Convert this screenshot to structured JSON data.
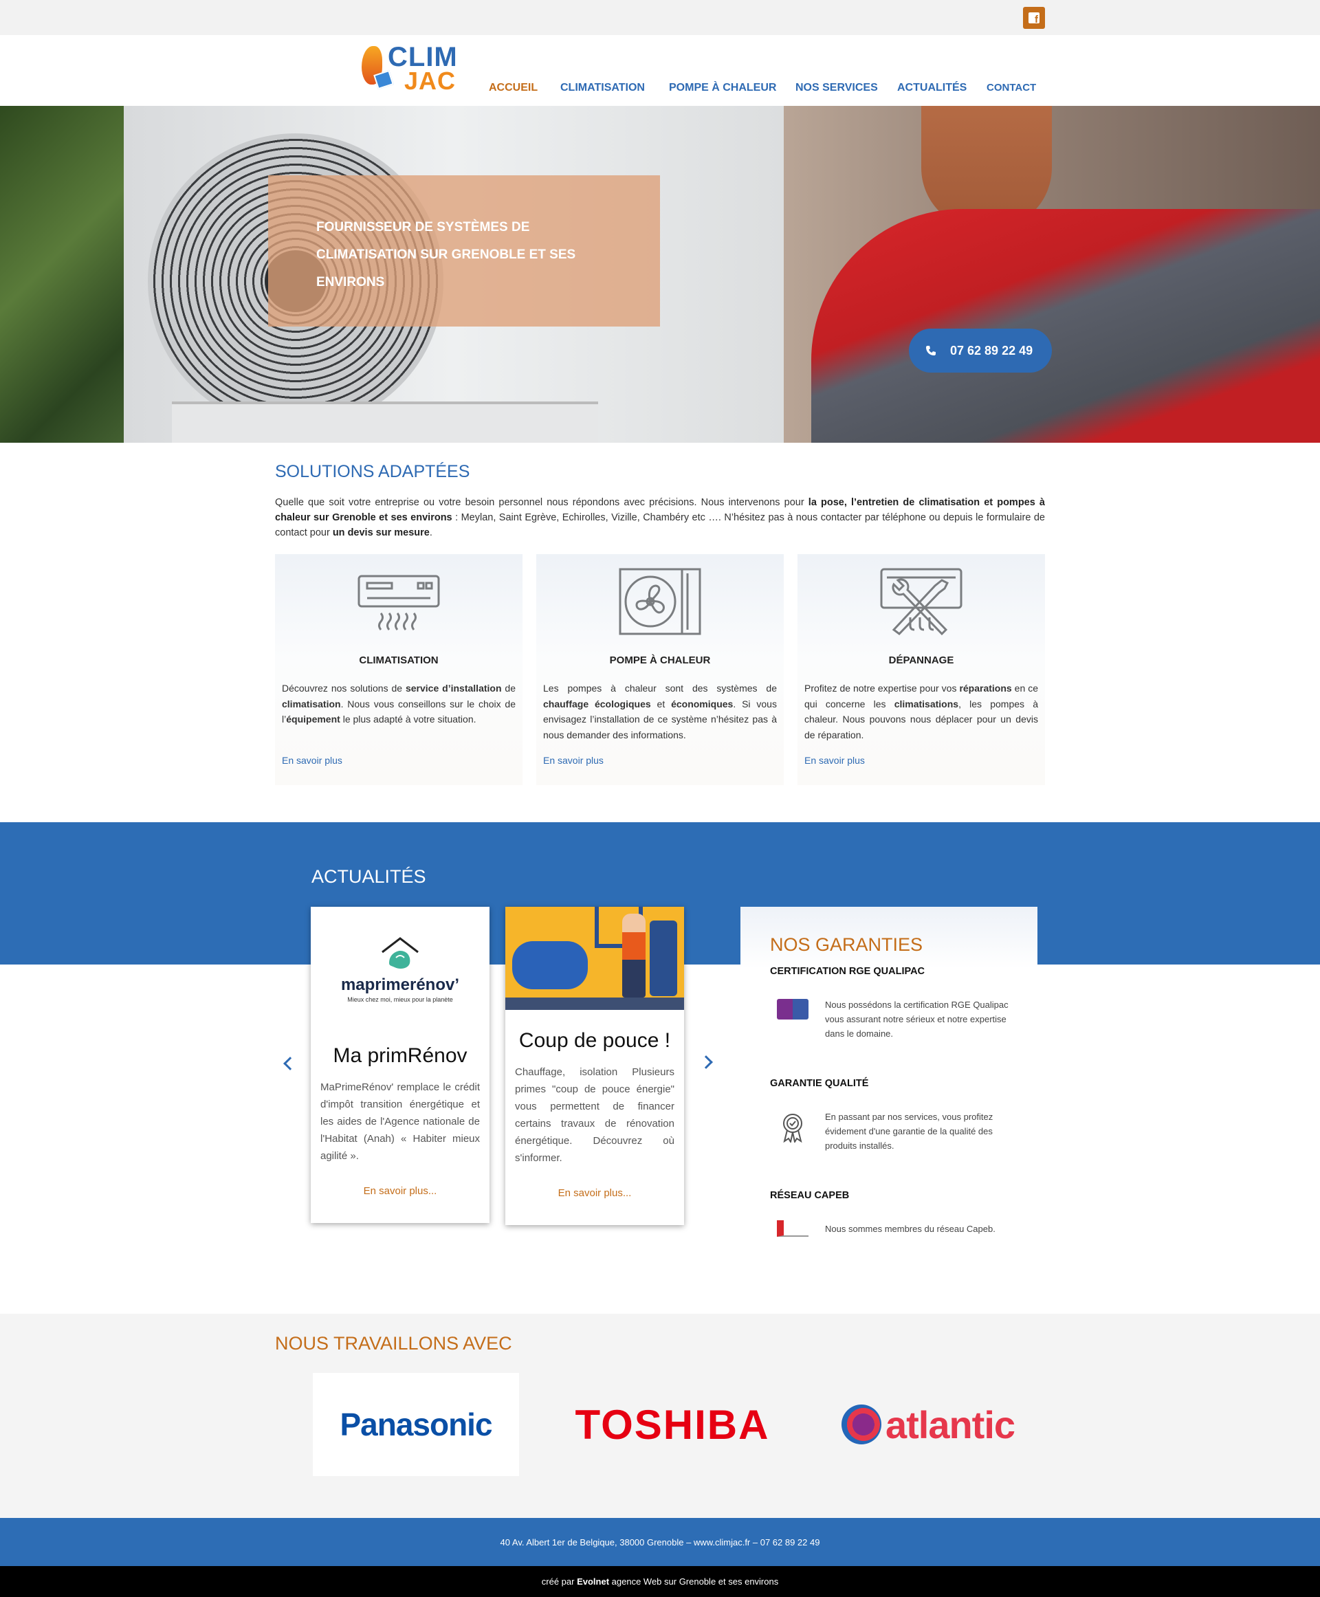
{
  "header": {
    "logo_line1": "CLIM",
    "logo_line2": "JAC",
    "nav": [
      "ACCUEIL",
      "CLIMATISATION",
      "POMPE À CHALEUR",
      "NOS SERVICES",
      "ACTUALITÉS",
      "CONTACT"
    ],
    "active": "ACCUEIL"
  },
  "hero": {
    "caption": "FOURNISSEUR DE SYSTÈMES DE CLIMATISATION SUR GRENOBLE ET SES ENVIRONS",
    "phone": "07 62 89 22 49"
  },
  "solutions": {
    "title": "SOLUTIONS ADAPTÉES",
    "intro": {
      "p1": "Quelle que soit votre entreprise ou votre besoin personnel nous répondons avec précisions. Nous intervenons pour ",
      "b1": "la pose, l’entretien  de climatisation et pompes à chaleur sur Grenoble et ses environs",
      "p2": " : Meylan, Saint Egrève, Echirolles, Vizille, Chambéry etc …. N’hésitez pas à nous contacter par téléphone ou depuis le formulaire de contact pour ",
      "b2": "un devis sur mesure",
      "p3": "."
    },
    "cards": [
      {
        "icon": "air-conditioner-icon",
        "title": "CLIMATISATION",
        "desc_parts": [
          "Découvrez nos solutions de ",
          "service d’installation",
          " de ",
          "climatisation",
          ". Nous vous conseillons sur le choix de l’",
          "équipement",
          " le plus adapté à votre situation."
        ],
        "link": "En savoir plus"
      },
      {
        "icon": "heat-pump-fan-icon",
        "title": "POMPE À CHALEUR",
        "desc_parts": [
          "Les pompes à chaleur sont des systèmes de ",
          "chauffage écologiques",
          " et ",
          "économiques",
          ". Si vous envisagez l’installation de ce système n’hésitez pas à nous demander des informations."
        ],
        "link": "En savoir plus"
      },
      {
        "icon": "tools-repair-icon",
        "title": "DÉPANNAGE",
        "desc_parts": [
          "Profitez de notre expertise pour vos ",
          "réparations",
          " en ce qui concerne les ",
          "climatisations",
          ", les pompes à chaleur. Nous pouvons nous déplacer pour un devis de réparation."
        ],
        "link": "En savoir plus"
      }
    ]
  },
  "actualites": {
    "title": "ACTUALITÉS",
    "news": [
      {
        "logo_text": "maprimerénov’",
        "logo_sub": "Mieux chez moi, mieux pour la planète",
        "title": "Ma primRénov",
        "desc": "MaPrimeRénov' remplace le crédit d'impôt transition énergétique et les aides de l'Agence nationale de l'Habitat (Anah) « Habiter mieux agilité ».",
        "more": "En savoir plus..."
      },
      {
        "title": "Coup de pouce !",
        "desc": "Chauffage, isolation Plusieurs primes \"coup de pouce énergie\" vous permettent de financer certains travaux de rénovation énergétique. Découvrez où s'informer.",
        "more": "En savoir plus..."
      }
    ]
  },
  "garanties": {
    "title": "NOS GARANTIES",
    "items": [
      {
        "heading": "CERTIFICATION RGE QUALIPAC",
        "icon": "rge-qualipac-badge-icon",
        "desc": "Nous possédons la certification RGE Qualipac vous assurant notre sérieux et notre expertise dans le domaine."
      },
      {
        "heading": "GARANTIE QUALITÉ",
        "icon": "quality-medal-icon",
        "desc": "En passant par nos services, vous profitez évidement d'une garantie de la qualité des produits installés."
      },
      {
        "heading": "RÉSEAU CAPEB",
        "icon": "capeb-logo-icon",
        "desc": "Nous sommes membres du réseau Capeb."
      }
    ]
  },
  "partners": {
    "title": "NOUS TRAVAILLONS AVEC",
    "logos": [
      "Panasonic",
      "TOSHIBA",
      "atlantic"
    ]
  },
  "footer": {
    "address": "40 Av. Albert 1er de Belgique, 38000 Grenoble – www.climjac.fr – 07 62 89 22 49",
    "credit_pre": "créé par ",
    "credit_brand": "Evolnet",
    "credit_post": " agence Web sur Grenoble et ses environs"
  },
  "colors": {
    "brand_blue": "#2e6ab3",
    "band_blue": "#2d6db5",
    "accent_orange": "#c46d19"
  }
}
